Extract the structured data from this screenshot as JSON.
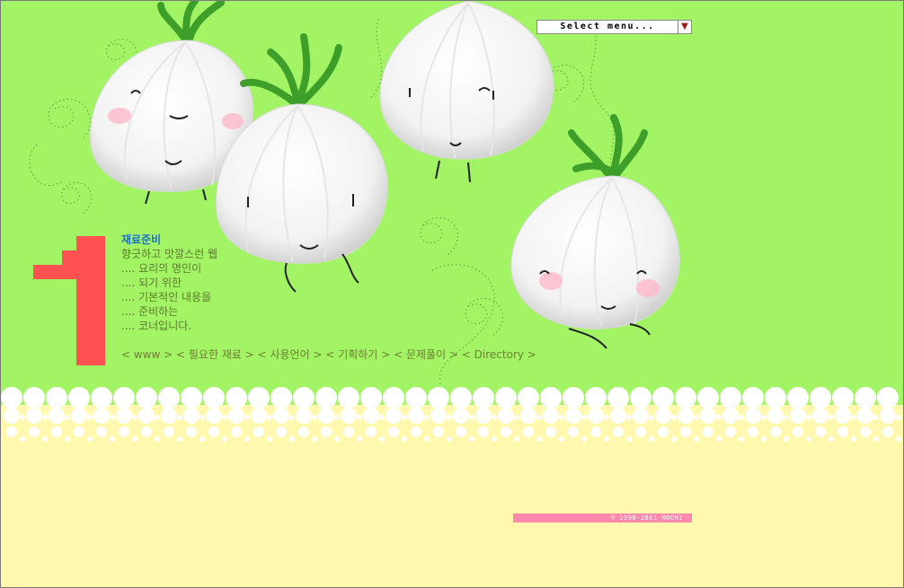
{
  "menu": {
    "select_label": "Select menu...",
    "arrow_icon": "chevron-down-icon"
  },
  "intro": {
    "title": "재료준비",
    "lines": [
      "향긋하고 맛깔스런 웹",
      ".... 요리의 명인이",
      ".... 되기 위한",
      ".... 기본적인 내용을",
      ".... 준비하는",
      ".... 코너입니다."
    ]
  },
  "nav": {
    "items": [
      "< www >",
      "< 필요한 재료 >",
      "< 사용언어 >",
      "< 기획하기 >",
      "< 문제풀이 >",
      "< Directory >"
    ]
  },
  "footer": {
    "copyright": "© 1998-2001 MOONI"
  },
  "colors": {
    "green_bg": "#a2f464",
    "cream_bg": "#fff8ae",
    "number_red": "#ff5151",
    "title_blue": "#1e6fc6",
    "copyright_pink": "#ff88ad"
  },
  "illustration": {
    "subject": "cartoon garlic bulbs with faces",
    "count": 4,
    "big_number": "1"
  }
}
